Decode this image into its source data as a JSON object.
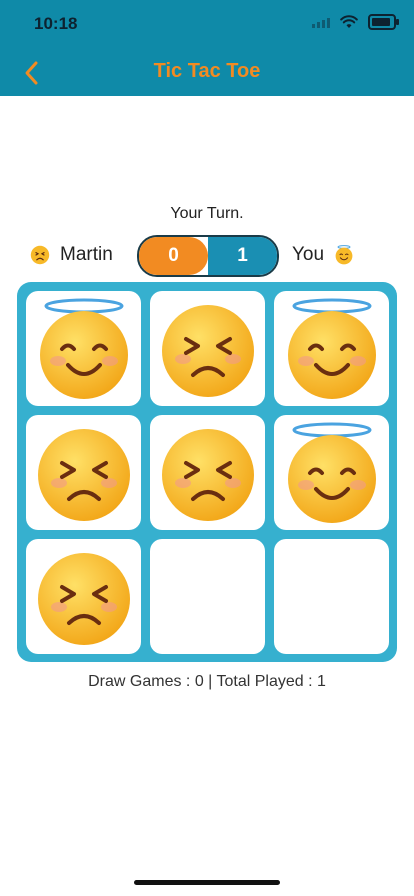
{
  "status": {
    "time": "10:18"
  },
  "header": {
    "title": "Tic Tac Toe"
  },
  "game": {
    "turn_text": "Your Turn.",
    "player_left": {
      "name": "Martin",
      "score": "0",
      "icon": "sad-face-icon"
    },
    "player_right": {
      "name": "You",
      "score": "1",
      "icon": "angel-face-icon"
    },
    "board": [
      "angel",
      "sad",
      "angel",
      "sad",
      "sad",
      "angel",
      "sad",
      "empty",
      "empty"
    ],
    "stats_text": "Draw Games : 0 | Total Played : 1"
  },
  "colors": {
    "header_bg": "#0f8aa8",
    "accent_orange": "#f28b22",
    "board_bg": "#36b0cf",
    "score_blue": "#1a8fb3"
  }
}
